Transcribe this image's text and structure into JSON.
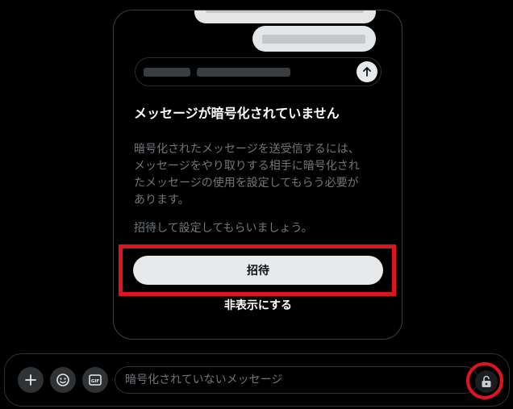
{
  "notice": {
    "title": "メッセージが暗号化されていません",
    "body_line1": "暗号化されたメッセージを送受信するには、",
    "body_line2": "メッセージをやり取りする相手に暗号化され",
    "body_line3": "たメッセージの使用を設定してもらう必要が",
    "body_line4": "あります。",
    "hint": "招待して設定してもらいましょう。",
    "invite_label": "招待",
    "hide_label": "非表示にする"
  },
  "composer": {
    "placeholder": "暗号化されていないメッセージ",
    "value": ""
  },
  "icons": {
    "send": "arrow-up-icon",
    "add": "plus-icon",
    "emoji": "emoji-icon",
    "gif": "gif-icon",
    "lock": "unlocked-padlock-icon"
  },
  "colors": {
    "highlight": "#e0141b",
    "button_bg": "#e7e9ea",
    "muted_text": "#71767b"
  }
}
